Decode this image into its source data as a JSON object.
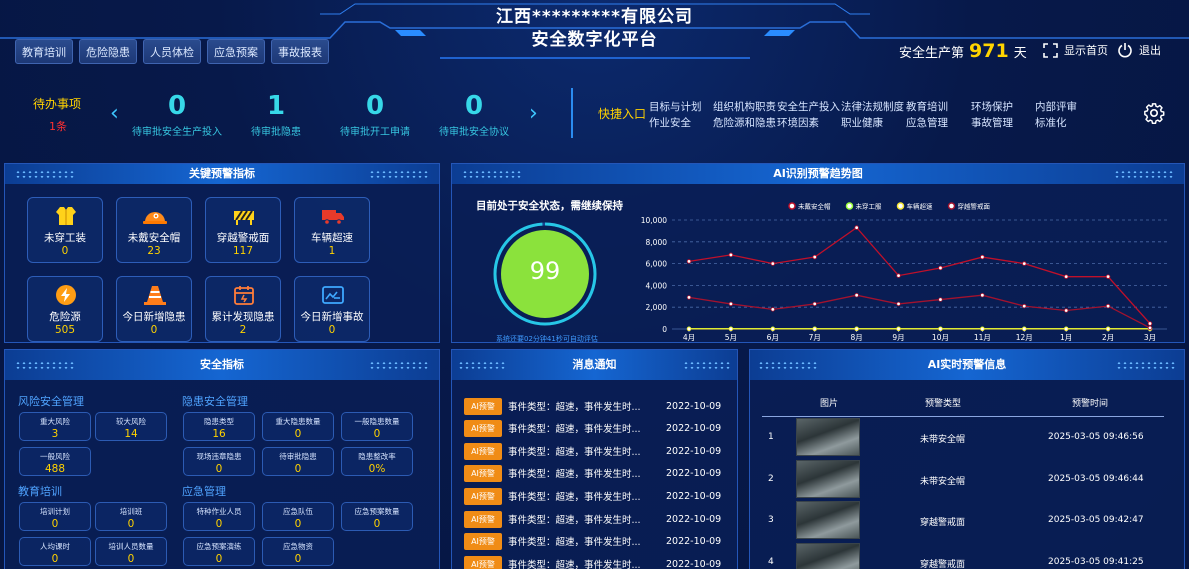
{
  "header": {
    "company": "江西*********有限公司",
    "platform": "安全数字化平台",
    "nav": [
      "教育培训",
      "危险隐患",
      "人员体检",
      "应急预案",
      "事故报表"
    ],
    "days_label_pre": "安全生产第",
    "days_value": "971",
    "days_label_post": "天",
    "home_label": "显示首页",
    "logout_label": "退出"
  },
  "todo": {
    "title": "待办事项",
    "count": "1条",
    "stats": [
      {
        "value": "0",
        "label": "待审批安全生产投入"
      },
      {
        "value": "1",
        "label": "待审批隐患"
      },
      {
        "value": "0",
        "label": "待审批开工申请"
      },
      {
        "value": "0",
        "label": "待审批安全协议"
      }
    ]
  },
  "quick": {
    "title": "快捷入口",
    "links": [
      "目标与计划",
      "组织机构职责",
      "安全生产投入",
      "法律法规制度",
      "教育培训",
      "环场保护",
      "内部评审",
      "作业安全",
      "危险源和隐患",
      "环境因素",
      "职业健康",
      "应急管理",
      "事故管理",
      "标准化"
    ]
  },
  "key_warnings": {
    "title": "关键预警指标",
    "items": [
      {
        "label": "未穿工装",
        "value": "0",
        "icon": "vest-icon"
      },
      {
        "label": "未戴安全帽",
        "value": "23",
        "icon": "helmet-icon"
      },
      {
        "label": "穿越警戒面",
        "value": "117",
        "icon": "barrier-icon"
      },
      {
        "label": "车辆超速",
        "value": "1",
        "icon": "truck-icon"
      },
      {
        "label": "危险源",
        "value": "505",
        "icon": "lightning-icon"
      },
      {
        "label": "今日新增隐患",
        "value": "0",
        "icon": "cone-icon"
      },
      {
        "label": "累计发现隐患",
        "value": "2",
        "icon": "calendar-icon"
      },
      {
        "label": "今日新增事故",
        "value": "0",
        "icon": "report-icon"
      }
    ]
  },
  "ai_trend": {
    "title": "AI识别预警趋势图",
    "status": "目前处于安全状态，需继续保持",
    "score": "99",
    "score_fraction": 0.99,
    "note": "系统还要02分钟41秒可自动评估"
  },
  "chart_data": {
    "type": "line",
    "categories": [
      "4月",
      "5月",
      "6月",
      "7月",
      "8月",
      "9月",
      "10月",
      "11月",
      "12月",
      "1月",
      "2月",
      "3月"
    ],
    "ylim": [
      0,
      10000
    ],
    "yticks": [
      "0",
      "2,000",
      "4,000",
      "6,000",
      "8,000",
      "10,000"
    ],
    "legend_position": "top",
    "grid": true,
    "series": [
      {
        "name": "未戴安全帽",
        "color": "#c0102a",
        "values": [
          6200,
          6800,
          6000,
          6600,
          9300,
          4900,
          5600,
          6600,
          6000,
          4800,
          4800,
          500
        ]
      },
      {
        "name": "未穿工服",
        "color": "#9aff3a",
        "values": [
          30,
          30,
          30,
          30,
          30,
          30,
          30,
          30,
          30,
          30,
          30,
          30
        ]
      },
      {
        "name": "车辆超速",
        "color": "#f5e531",
        "values": [
          10,
          10,
          10,
          10,
          10,
          10,
          10,
          10,
          10,
          10,
          10,
          10
        ]
      },
      {
        "name": "穿越警戒面",
        "color": "#a3122e",
        "values": [
          2900,
          2300,
          1800,
          2300,
          3100,
          2300,
          2700,
          3100,
          2100,
          1700,
          2100,
          100
        ]
      }
    ]
  },
  "safety": {
    "title": "安全指标",
    "groups": [
      {
        "title": "风险安全管理",
        "items": [
          {
            "label": "重大风险",
            "value": "3"
          },
          {
            "label": "较大风险",
            "value": "14"
          },
          {
            "label": "一般风险",
            "value": "488"
          }
        ]
      },
      {
        "title": "隐患安全管理",
        "items": [
          {
            "label": "隐患类型",
            "value": "16"
          },
          {
            "label": "重大隐患数量",
            "value": "0"
          },
          {
            "label": "一般隐患数量",
            "value": "0"
          },
          {
            "label": "现场违章隐患",
            "value": "0"
          },
          {
            "label": "待审批隐患",
            "value": "0"
          },
          {
            "label": "隐患整改率",
            "value": "0%"
          }
        ]
      },
      {
        "title": "教育培训",
        "items": [
          {
            "label": "培训计划",
            "value": "0"
          },
          {
            "label": "培训班",
            "value": "0"
          },
          {
            "label": "人均课时",
            "value": "0"
          },
          {
            "label": "培训人员数量",
            "value": "0"
          }
        ]
      },
      {
        "title": "应急管理",
        "items": [
          {
            "label": "特种作业人员",
            "value": "0"
          },
          {
            "label": "应急队伍",
            "value": "0"
          },
          {
            "label": "应急预案数量",
            "value": "0"
          },
          {
            "label": "应急预案演练",
            "value": "0"
          },
          {
            "label": "应急物资",
            "value": "0"
          }
        ]
      }
    ]
  },
  "messages": {
    "title": "消息通知",
    "items": [
      {
        "badge": "AI预警",
        "text": "事件类型：超速，事件发生时...",
        "date": "2022-10-09"
      },
      {
        "badge": "AI预警",
        "text": "事件类型：超速，事件发生时...",
        "date": "2022-10-09"
      },
      {
        "badge": "AI预警",
        "text": "事件类型：超速，事件发生时...",
        "date": "2022-10-09"
      },
      {
        "badge": "AI预警",
        "text": "事件类型：超速，事件发生时...",
        "date": "2022-10-09"
      },
      {
        "badge": "AI预警",
        "text": "事件类型：超速，事件发生时...",
        "date": "2022-10-09"
      },
      {
        "badge": "AI预警",
        "text": "事件类型：超速，事件发生时...",
        "date": "2022-10-09"
      },
      {
        "badge": "AI预警",
        "text": "事件类型：超速，事件发生时...",
        "date": "2022-10-09"
      },
      {
        "badge": "AI预警",
        "text": "事件类型：超速，事件发生时...",
        "date": "2022-10-09"
      }
    ]
  },
  "ai_realtime": {
    "title": "AI实时预警信息",
    "columns": [
      "图片",
      "预警类型",
      "预警时间"
    ],
    "rows": [
      {
        "no": "1",
        "type": "未带安全帽",
        "time": "2025-03-05 09:46:56"
      },
      {
        "no": "2",
        "type": "未带安全帽",
        "time": "2025-03-05 09:46:44"
      },
      {
        "no": "3",
        "type": "穿越警戒面",
        "time": "2025-03-05 09:42:47"
      },
      {
        "no": "4",
        "type": "穿越警戒面",
        "time": "2025-03-05 09:41:25"
      }
    ]
  }
}
